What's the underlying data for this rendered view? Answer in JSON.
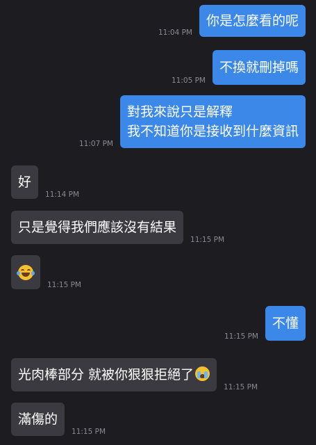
{
  "messages": [
    {
      "direction": "out",
      "lines": [
        "你是怎麼看的呢"
      ],
      "time": "11:04 PM"
    },
    {
      "direction": "out",
      "lines": [
        "不換就刪掉嗎"
      ],
      "time": "11:05 PM"
    },
    {
      "direction": "out",
      "lines": [
        "對我來說只是解釋",
        "我不知道你是接收到什麼資訊"
      ],
      "time": "11:07 PM"
    },
    {
      "direction": "in",
      "lines": [
        "好"
      ],
      "time": "11:14 PM"
    },
    {
      "direction": "in",
      "lines": [
        "只是覺得我們應該沒有結果"
      ],
      "time": "11:15 PM"
    },
    {
      "direction": "in",
      "emoji": "face-with-tears-of-joy",
      "time": "11:15 PM"
    },
    {
      "direction": "out",
      "lines": [
        "不懂"
      ],
      "time": "11:15 PM"
    },
    {
      "direction": "in",
      "lines": [
        "光肉棒部分 就被你狠狠拒絕了"
      ],
      "trailing_emoji": "loudly-crying-face",
      "time": "11:15 PM"
    },
    {
      "direction": "in",
      "lines": [
        "滿傷的"
      ],
      "time": "11:15 PM"
    }
  ]
}
